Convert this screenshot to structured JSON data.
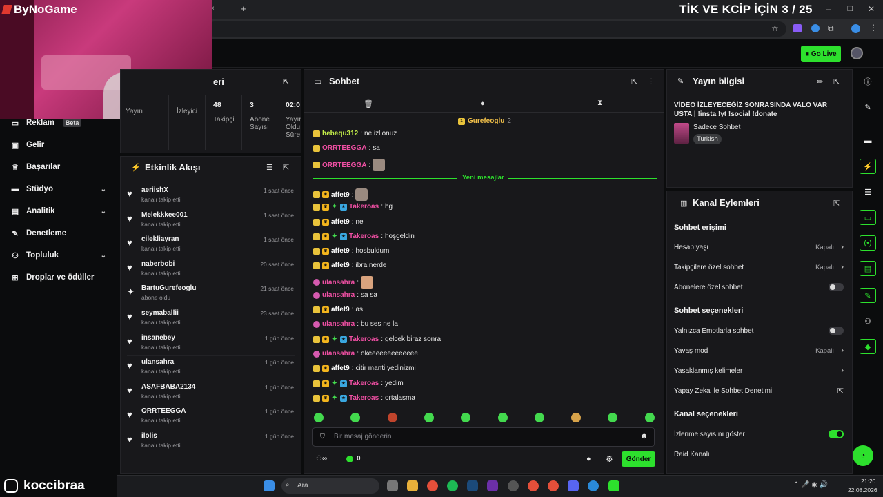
{
  "overlay": {
    "title": "TİK VE KCİP İÇİN 3 / 25",
    "logo": "ByNoGame"
  },
  "browser": {
    "tab_close": "×",
    "new_tab": "+",
    "minimize": "–",
    "restore": "❐",
    "close": "✕"
  },
  "header": {
    "go_live": "Go Live"
  },
  "nav": {
    "items": [
      {
        "label": "Reklam",
        "badge": "Beta",
        "icon": "billboard-icon"
      },
      {
        "label": "Gelir",
        "icon": "dollar-icon"
      },
      {
        "label": "Başarılar",
        "icon": "trophy-icon"
      },
      {
        "label": "Stüdyo",
        "icon": "studio-icon"
      },
      {
        "label": "Analitik",
        "icon": "chart-icon"
      },
      {
        "label": "Denetleme",
        "icon": "wrench-icon"
      },
      {
        "label": "Topluluk",
        "icon": "people-icon"
      },
      {
        "label": "Droplar ve ödüller",
        "icon": "gift-icon"
      }
    ]
  },
  "stats": {
    "title_suffix": "eri",
    "items": [
      {
        "value": "",
        "label": "Yayın"
      },
      {
        "value": "",
        "label": "İzleyici"
      },
      {
        "value": "48",
        "label": "Takipçi"
      },
      {
        "value": "3",
        "label": "Abone Sayısı"
      },
      {
        "value": "02:0",
        "label": "Yayın Oldu Süre"
      }
    ]
  },
  "events": {
    "title": "Etkinlik Akışı",
    "items": [
      {
        "name": "aeriishX",
        "sub": "kanalı takip etti",
        "time": "1 saat önce",
        "icon": "heart"
      },
      {
        "name": "Melekkkee001",
        "sub": "kanalı takip etti",
        "time": "1 saat önce",
        "icon": "heart"
      },
      {
        "name": "cilekliayran",
        "sub": "kanalı takip etti",
        "time": "1 saat önce",
        "icon": "heart"
      },
      {
        "name": "naberbobi",
        "sub": "kanalı takip etti",
        "time": "20 saat önce",
        "icon": "heart"
      },
      {
        "name": "BartuGurefeoglu",
        "sub": "abone oldu",
        "time": "21 saat önce",
        "icon": "sparkle"
      },
      {
        "name": "seymaballii",
        "sub": "kanalı takip etti",
        "time": "23 saat önce",
        "icon": "heart"
      },
      {
        "name": "insanebey",
        "sub": "kanalı takip etti",
        "time": "1 gün önce",
        "icon": "heart"
      },
      {
        "name": "ulansahra",
        "sub": "kanalı takip etti",
        "time": "1 gün önce",
        "icon": "heart"
      },
      {
        "name": "ASAFBABA2134",
        "sub": "kanalı takip etti",
        "time": "1 gün önce",
        "icon": "heart"
      },
      {
        "name": "ORRTEEGGA",
        "sub": "kanalı takip etti",
        "time": "1 gün önce",
        "icon": "heart"
      },
      {
        "name": "ilolis",
        "sub": "kanalı takip etti",
        "time": "1 gün önce",
        "icon": "heart"
      }
    ]
  },
  "chat": {
    "title": "Sohbet",
    "pinned_user": "Gurefeoglu",
    "pinned_count": "2",
    "new_messages": "Yeni mesajlar",
    "messages": [
      {
        "user": "hebequ312",
        "text": "ne izlionuz",
        "color": "y",
        "badges": [
          "sub"
        ]
      },
      {
        "user": "ORRTEEGGA",
        "text": "sa",
        "color": "p",
        "badges": [
          "sub"
        ]
      },
      {
        "user": "ORRTEEGGA",
        "text": "",
        "color": "p",
        "badges": [
          "sub"
        ],
        "emote": true
      },
      {
        "user": "affet9",
        "text": "",
        "color": "w",
        "badges": [
          "sub",
          "crown"
        ],
        "emote": true
      },
      {
        "user": "Takeroas",
        "text": "hg",
        "color": "p",
        "badges": [
          "sub",
          "crown",
          "green",
          "blue"
        ]
      },
      {
        "user": "affet9",
        "text": "ne",
        "color": "w",
        "badges": [
          "sub",
          "crown"
        ]
      },
      {
        "user": "Takeroas",
        "text": "hoşgeldin",
        "color": "p",
        "badges": [
          "sub",
          "crown",
          "green",
          "blue"
        ]
      },
      {
        "user": "affet9",
        "text": "hosbuldum",
        "color": "w",
        "badges": [
          "sub",
          "crown"
        ]
      },
      {
        "user": "affet9",
        "text": "ibra nerde",
        "color": "w",
        "badges": [
          "sub",
          "crown"
        ]
      },
      {
        "user": "ulansahra",
        "text": "",
        "color": "p",
        "badges": [
          "pink"
        ],
        "emote": true
      },
      {
        "user": "ulansahra",
        "text": "sa sa",
        "color": "p",
        "badges": [
          "pink"
        ]
      },
      {
        "user": "affet9",
        "text": "as",
        "color": "w",
        "badges": [
          "sub",
          "crown"
        ]
      },
      {
        "user": "ulansahra",
        "text": "bu ses ne la",
        "color": "p",
        "badges": [
          "pink"
        ]
      },
      {
        "user": "Takeroas",
        "text": "gelcek biraz sonra",
        "color": "p",
        "badges": [
          "sub",
          "crown",
          "green",
          "blue"
        ]
      },
      {
        "user": "ulansahra",
        "text": "okeeeeeeeeeeeee",
        "color": "p",
        "badges": [
          "pink"
        ]
      },
      {
        "user": "affet9",
        "text": "citir manti yedinizmi",
        "color": "w",
        "badges": [
          "sub",
          "crown"
        ]
      },
      {
        "user": "Takeroas",
        "text": "yedim",
        "color": "p",
        "badges": [
          "sub",
          "crown",
          "green",
          "blue"
        ]
      },
      {
        "user": "Takeroas",
        "text": "ortalasma",
        "color": "p",
        "badges": [
          "sub",
          "crown",
          "green",
          "blue"
        ]
      }
    ],
    "input_placeholder": "Bir mesaj gönderin",
    "points": "0",
    "send": "Gönder"
  },
  "info": {
    "title": "Yayın bilgisi",
    "stream_title": "VİDEO İZLEYECEĞİZ SONRASINDA VALO VAR USTA | !insta !yt !social !donate",
    "category": "Sadece Sohbet",
    "language": "Turkish"
  },
  "actions": {
    "title": "Kanal Eylemleri",
    "sections": [
      {
        "heading": "Sohbet erişimi",
        "rows": [
          {
            "label": "Hesap yaşı",
            "value": "Kapalı",
            "type": "arrow"
          },
          {
            "label": "Takipçilere özel sohbet",
            "value": "Kapalı",
            "type": "arrow"
          },
          {
            "label": "Abonelere özel sohbet",
            "value": "",
            "type": "toggle-off"
          }
        ]
      },
      {
        "heading": "Sohbet seçenekleri",
        "rows": [
          {
            "label": "Yalnızca Emotlarla sohbet",
            "value": "",
            "type": "toggle-off"
          },
          {
            "label": "Yavaş mod",
            "value": "Kapalı",
            "type": "arrow"
          },
          {
            "label": "Yasaklanmış kelimeler",
            "value": "",
            "type": "arrow"
          },
          {
            "label": "Yapay Zeka ile Sohbet Denetimi",
            "value": "",
            "type": "external"
          }
        ]
      },
      {
        "heading": "Kanal seçenekleri",
        "rows": [
          {
            "label": "İzlenme sayısını göster",
            "value": "",
            "type": "toggle-on"
          },
          {
            "label": "Raid Kanalı",
            "value": "",
            "type": "none"
          }
        ]
      }
    ]
  },
  "taskbar": {
    "username": "koccibraa",
    "search": "Ara",
    "time": "21:20",
    "date": "22.08.2026"
  },
  "colors": {
    "accent": "#2de02d",
    "panel": "#18181b",
    "background": "#0b0c0d",
    "pink_user": "#ef4fa3",
    "yellow_user": "#c6f14a"
  }
}
